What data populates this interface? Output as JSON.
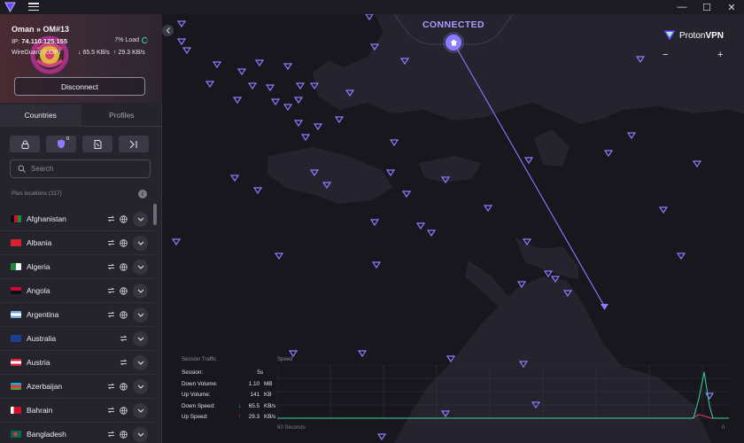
{
  "window": {
    "controls": [
      "—",
      "☐",
      "✕"
    ]
  },
  "connection": {
    "location": "Oman » OM#13",
    "ip_label": "IP:",
    "ip_value": "74.110.125.155",
    "load": "7% Load",
    "protocol": "WireGuard (UDP)",
    "down_speed": "65.5 KB/s",
    "up_speed": "29.3 KB/s",
    "disconnect_label": "Disconnect"
  },
  "tabs": [
    {
      "label": "Countries",
      "active": true
    },
    {
      "label": "Profiles",
      "active": false
    }
  ],
  "features": {
    "netshield_badge": "0"
  },
  "search": {
    "placeholder": "Search"
  },
  "list": {
    "header": "Plus locations (117)",
    "info": "i",
    "countries": [
      {
        "name": "Afghanistan",
        "p2p": true
      },
      {
        "name": "Albania",
        "p2p": true
      },
      {
        "name": "Algeria",
        "p2p": true
      },
      {
        "name": "Angola",
        "p2p": true
      },
      {
        "name": "Argentina",
        "p2p": true
      },
      {
        "name": "Australia",
        "p2p": false
      },
      {
        "name": "Austria",
        "p2p": false
      },
      {
        "name": "Azerbaijan",
        "p2p": true
      },
      {
        "name": "Bahrain",
        "p2p": true
      },
      {
        "name": "Bangladesh",
        "p2p": true
      }
    ]
  },
  "map": {
    "status": "CONNECTED",
    "brand_name": "Proton",
    "brand_product": "VPN",
    "zoom_out": "−",
    "zoom_in": "+",
    "accent": "#8b7bff"
  },
  "traffic": {
    "title": "Session Traffic",
    "speed_title": "Speed",
    "session_label": "Session:",
    "session_value": "5s",
    "down_volume_label": "Down Volume:",
    "down_volume_value": "1.10",
    "down_volume_unit": "MB",
    "up_volume_label": "Up Volume:",
    "up_volume_value": "141",
    "up_volume_unit": "KB",
    "down_speed_label": "Down Speed:",
    "down_speed_value": "65.5",
    "down_speed_unit": "KB/s",
    "up_speed_label": "Up Speed:",
    "up_speed_value": "29.3",
    "up_speed_unit": "KB/s",
    "graph_left": "60 Seconds",
    "graph_right": "0",
    "down_color": "#3bd1a0",
    "up_color": "#e0435a"
  }
}
